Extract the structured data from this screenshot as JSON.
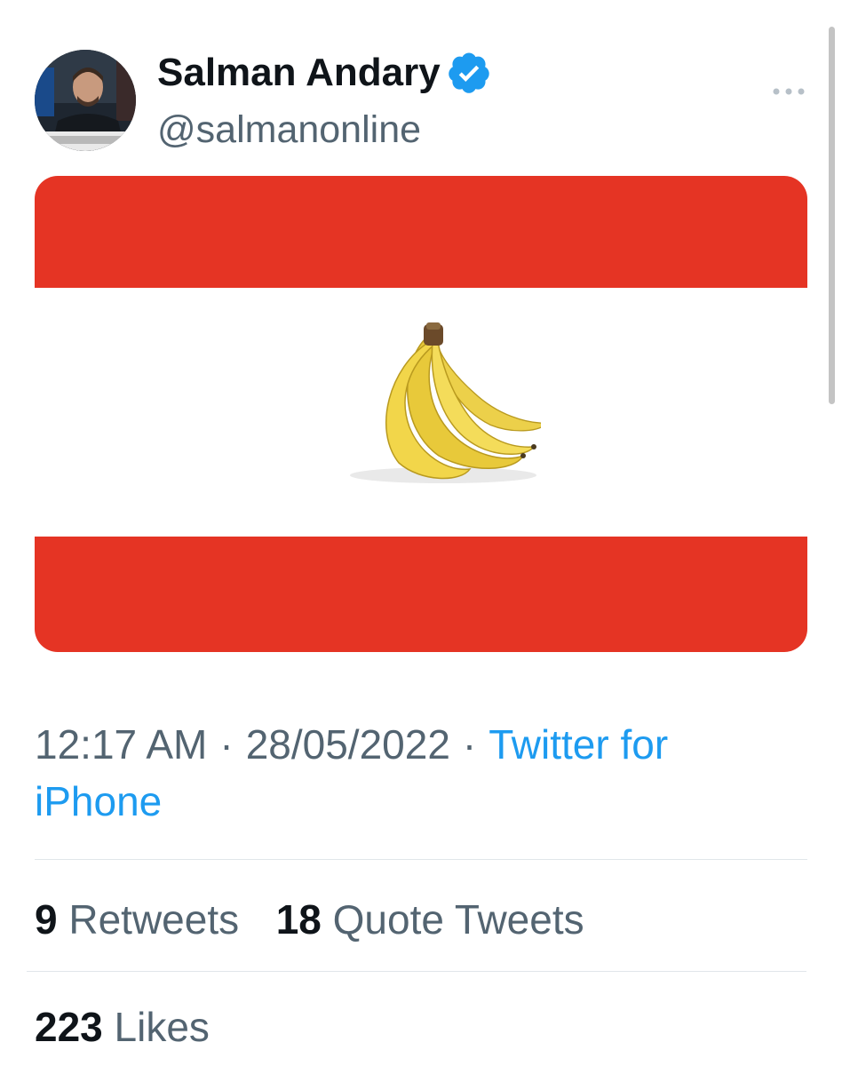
{
  "tweet": {
    "author": {
      "name": "Salman Andary",
      "handle": "@salmanonline",
      "verified": true,
      "avatar_icon": "avatar-photo"
    },
    "media": {
      "description_icon": "lebanon-flag-banana",
      "band_color": "#e53424",
      "center_color": "#ffffff"
    },
    "meta": {
      "time": "12:17 AM",
      "date": "28/05/2022",
      "separator": "·",
      "source": "Twitter for iPhone"
    },
    "stats": {
      "retweets_count": "9",
      "retweets_label": "Retweets",
      "quotes_count": "18",
      "quotes_label": "Quote Tweets",
      "likes_count": "223",
      "likes_label": "Likes"
    }
  },
  "colors": {
    "text_primary": "#0f1419",
    "text_secondary": "#536471",
    "link": "#1d9bf0",
    "verified": "#1d9bf0",
    "divider": "#e1e6ea"
  },
  "icons": {
    "verified": "verified-badge-icon",
    "more": "more-dots-icon"
  }
}
